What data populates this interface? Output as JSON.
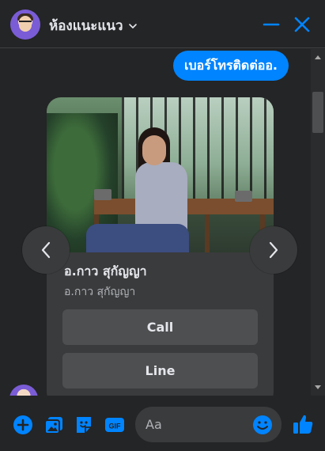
{
  "header": {
    "title": "ห้องแนะแนว",
    "icons": {
      "chevron": "chevron-down-icon",
      "minimize": "minimize-icon",
      "close": "close-icon"
    }
  },
  "messages": {
    "outgoing_text": "เบอร์โทรติดต่ออ."
  },
  "card": {
    "name": "อ.กาว สุกัญญา",
    "subtitle": "อ.กาว สุกัญญา",
    "buttons": {
      "call": "Call",
      "line": "Line"
    }
  },
  "composer": {
    "placeholder": "Aa",
    "value": ""
  },
  "colors": {
    "accent": "#0084ff",
    "background": "#242526",
    "card": "#3a3b3c",
    "button": "#4e4f50",
    "text": "#e4e6eb",
    "muted_text": "#b0b3b8"
  }
}
